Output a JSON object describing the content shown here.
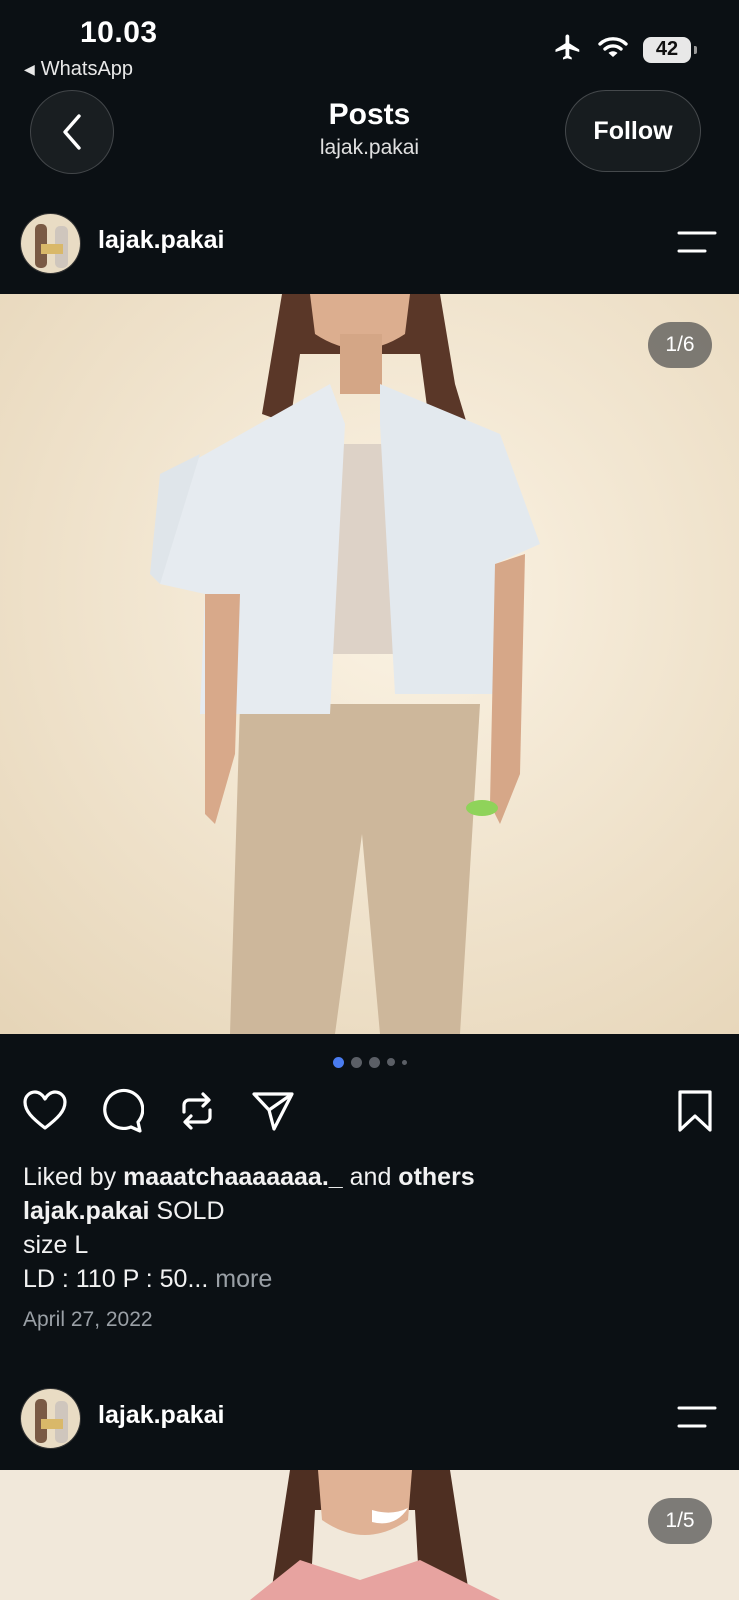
{
  "status_bar": {
    "time": "10.03",
    "back_app": "WhatsApp",
    "battery": "42",
    "icons": [
      "airplane-icon",
      "wifi-icon",
      "battery-icon"
    ]
  },
  "nav": {
    "title": "Posts",
    "subtitle": "lajak.pakai",
    "follow_label": "Follow"
  },
  "posts": [
    {
      "username": "lajak.pakai",
      "image_counter": "1/6",
      "carousel_dots": 5,
      "carousel_active_index": 0,
      "liked_by_prefix": "Liked by ",
      "liked_by_user": "maaatchaaaaaaa._",
      "liked_by_and": " and ",
      "liked_by_others": "others",
      "caption_user": "lajak.pakai",
      "caption_text": " SOLD",
      "caption_line2": "size L",
      "caption_line3": "LD : 110  P : 50...",
      "more_label": " more",
      "date": "April 27, 2022"
    },
    {
      "username": "lajak.pakai",
      "image_counter": "1/5"
    }
  ],
  "colors": {
    "background": "#0b1014",
    "active_dot": "#4a7cf0",
    "muted_text": "#9aa0a6"
  }
}
